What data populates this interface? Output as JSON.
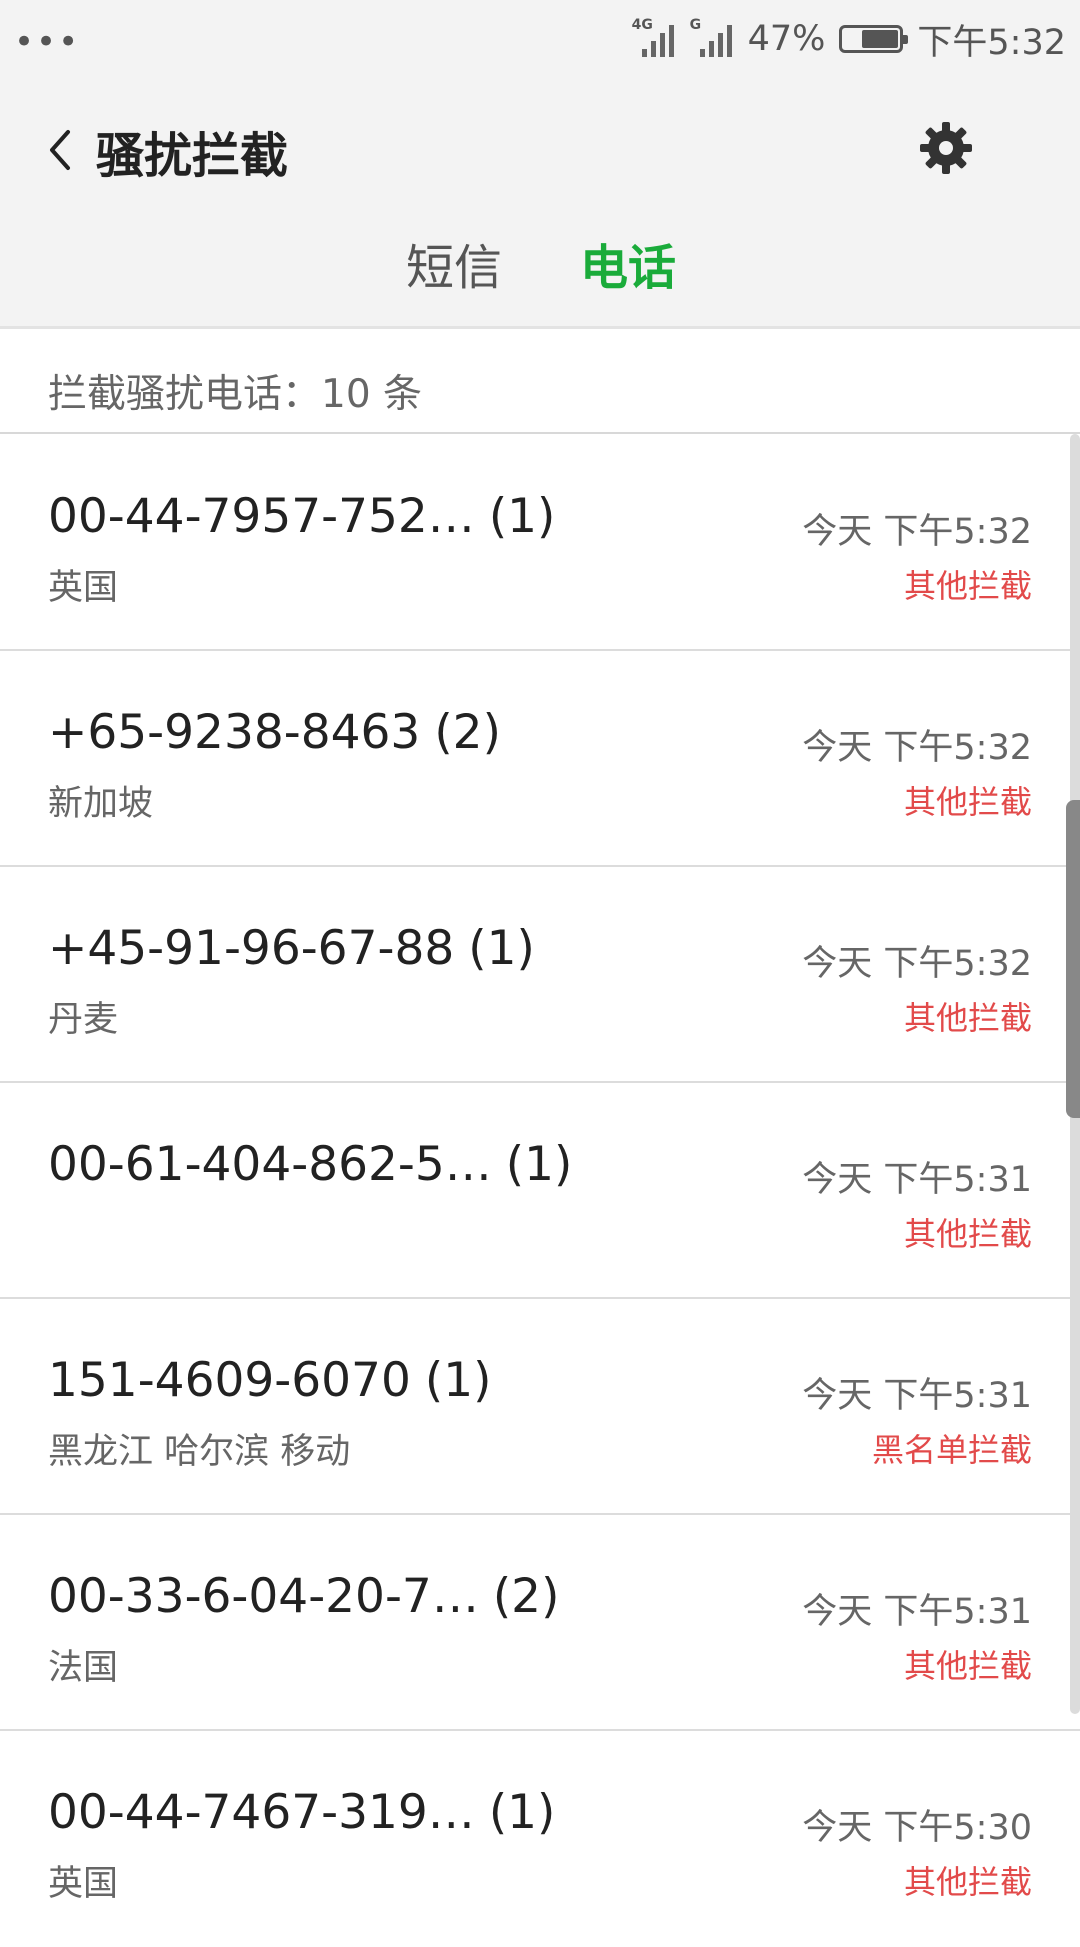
{
  "status_bar": {
    "dots": "•••",
    "network1": "4G",
    "network2": "G",
    "battery": "47%",
    "time": "下午5:32"
  },
  "header": {
    "title": "骚扰拦截",
    "back_icon": "chevron-left-icon",
    "settings_icon": "gear-icon"
  },
  "tabs": [
    {
      "label": "短信",
      "active": false
    },
    {
      "label": "电话",
      "active": true
    }
  ],
  "accent_color": "#1aab3a",
  "warning_color": "#e24a4a",
  "summary": "拦截骚扰电话：10 条",
  "calls": [
    {
      "number": "00-44-7957-752…",
      "count": "(1)",
      "location": "英国",
      "time": "今天 下午5:32",
      "type": "其他拦截"
    },
    {
      "number": "+65-9238-8463",
      "count": "(2)",
      "location": "新加坡",
      "time": "今天 下午5:32",
      "type": "其他拦截"
    },
    {
      "number": "+45-91-96-67-88",
      "count": "(1)",
      "location": "丹麦",
      "time": "今天 下午5:32",
      "type": "其他拦截"
    },
    {
      "number": "00-61-404-862-5…",
      "count": "(1)",
      "location": "",
      "time": "今天 下午5:31",
      "type": "其他拦截"
    },
    {
      "number": "151-4609-6070",
      "count": "(1)",
      "location": "黑龙江 哈尔滨 移动",
      "time": "今天 下午5:31",
      "type": "黑名单拦截"
    },
    {
      "number": "00-33-6-04-20-7…",
      "count": "(2)",
      "location": "法国",
      "time": "今天 下午5:31",
      "type": "其他拦截"
    },
    {
      "number": "00-44-7467-319…",
      "count": "(1)",
      "location": "英国",
      "time": "今天 下午5:30",
      "type": "其他拦截"
    }
  ]
}
